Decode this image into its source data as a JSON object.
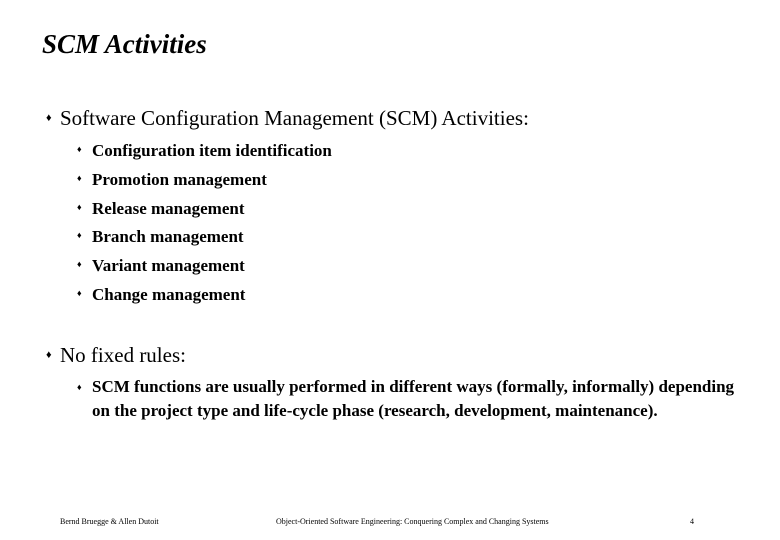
{
  "slide": {
    "title": "SCM Activities",
    "bullets": [
      {
        "icon": "diamond-bullet-icon",
        "glyph": "♦",
        "text": "Software Configuration Management (SCM) Activities:",
        "sub": [
          {
            "glyph": "♦",
            "text": "Configuration item identification"
          },
          {
            "glyph": "♦",
            "text": "Promotion management"
          },
          {
            "glyph": "♦",
            "text": "Release management"
          },
          {
            "glyph": "♦",
            "text": "Branch management"
          },
          {
            "glyph": "♦",
            "text": "Variant management"
          },
          {
            "glyph": "♦",
            "text": "Change management"
          }
        ]
      },
      {
        "icon": "diamond-bullet-icon",
        "glyph": "♦",
        "text": "No fixed rules:",
        "sub": [
          {
            "glyph": "♦",
            "text": "SCM functions are usually performed in different ways (formally, informally) depending on the project type and life-cycle phase (research, development, maintenance)."
          }
        ]
      }
    ]
  },
  "footer": {
    "authors": "Bernd Bruegge & Allen Dutoit",
    "book_title": "Object-Oriented Software Engineering: Conquering Complex and Changing Systems",
    "page_number": "4"
  }
}
